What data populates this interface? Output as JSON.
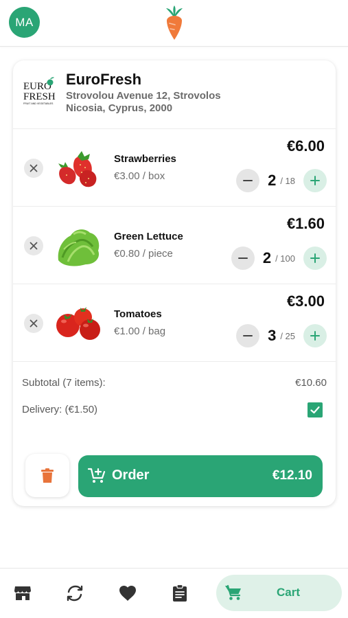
{
  "header": {
    "avatar_initials": "MA",
    "logo_icon": "carrot-icon"
  },
  "store": {
    "name": "EuroFresh",
    "address_line1": "Strovolou Avenue 12, Strovolos",
    "address_line2": "Nicosia, Cyprus, 2000",
    "logo_text_1": "EURO",
    "logo_text_2": "FRESH",
    "logo_tagline": "FRUIT AND VEGETABLES"
  },
  "items": [
    {
      "name": "Strawberries",
      "unit_price": "€3.00 / box",
      "total": "€6.00",
      "qty": "2",
      "max": "/ 18",
      "image": "strawberries-image"
    },
    {
      "name": "Green Lettuce",
      "unit_price": "€0.80 / piece",
      "total": "€1.60",
      "qty": "2",
      "max": "/ 100",
      "image": "lettuce-image"
    },
    {
      "name": "Tomatoes",
      "unit_price": "€1.00 / bag",
      "total": "€3.00",
      "qty": "3",
      "max": "/ 25",
      "image": "tomatoes-image"
    }
  ],
  "summary": {
    "subtotal_label": "Subtotal (7 items):",
    "subtotal_value": "€10.60",
    "delivery_label": "Delivery: (€1.50)",
    "delivery_checked": true
  },
  "actions": {
    "order_label": "Order",
    "order_total": "€12.10"
  },
  "nav": {
    "items": [
      "store-icon",
      "sync-icon",
      "heart-icon",
      "clipboard-icon"
    ],
    "cart_label": "Cart"
  },
  "colors": {
    "accent": "#2aa575",
    "accent_light": "#dff1e8",
    "trash": "#e8743b",
    "carrot": "#f07a3a"
  }
}
